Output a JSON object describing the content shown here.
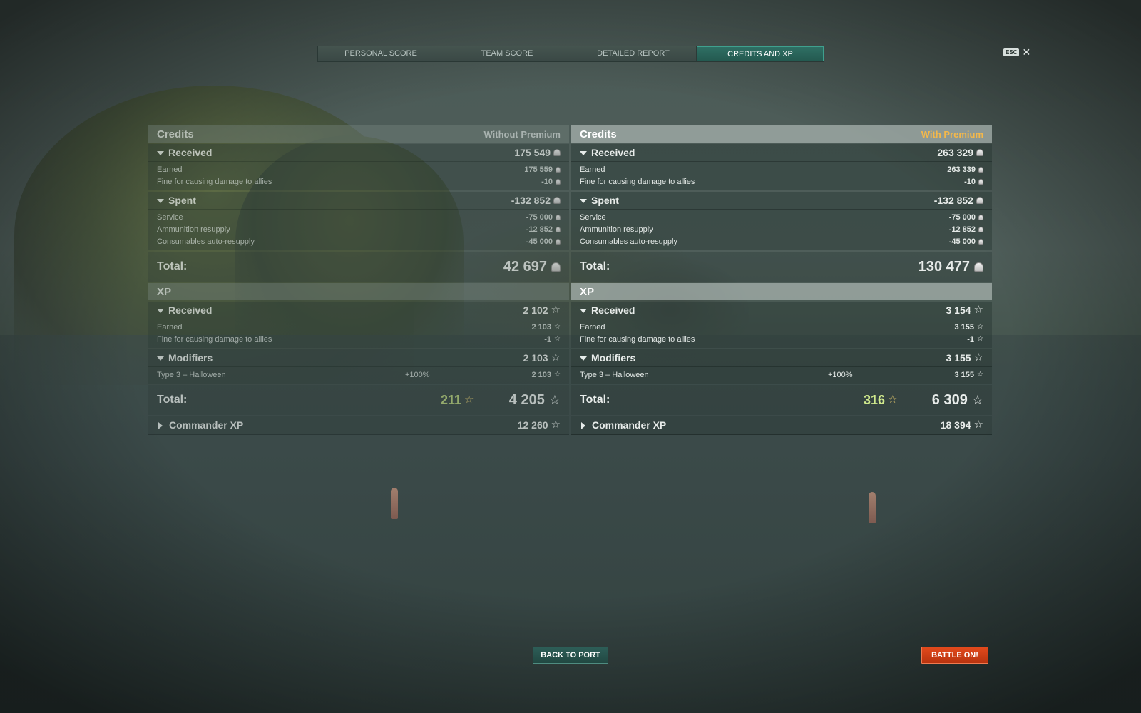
{
  "tabs": [
    {
      "label": "PERSONAL SCORE"
    },
    {
      "label": "TEAM SCORE"
    },
    {
      "label": "DETAILED REPORT"
    },
    {
      "label": "CREDITS AND XP",
      "active": true
    }
  ],
  "esc": {
    "badge": "ESC",
    "close": "✕"
  },
  "left": {
    "credits": {
      "title": "Credits",
      "subtitle": "Without Premium",
      "received": {
        "label": "Received",
        "value": "175 549"
      },
      "received_rows": [
        {
          "label": "Earned",
          "value": "175 559"
        },
        {
          "label": "Fine for causing damage to allies",
          "value": "-10"
        }
      ],
      "spent": {
        "label": "Spent",
        "value": "-132 852"
      },
      "spent_rows": [
        {
          "label": "Service",
          "value": "-75 000"
        },
        {
          "label": "Ammunition resupply",
          "value": "-12 852"
        },
        {
          "label": "Consumables auto-resupply",
          "value": "-45 000"
        }
      ],
      "total_label": "Total:",
      "total": "42 697"
    },
    "xp": {
      "title": "XP",
      "received": {
        "label": "Received",
        "value": "2 102"
      },
      "received_rows": [
        {
          "label": "Earned",
          "value": "2 103"
        },
        {
          "label": "Fine for causing damage to allies",
          "value": "-1"
        }
      ],
      "modifiers": {
        "label": "Modifiers",
        "value": "2 103"
      },
      "modifier_rows": [
        {
          "label": "Type 3 – Halloween",
          "percent": "+100%",
          "value": "2 103"
        }
      ],
      "total_label": "Total:",
      "bonus": "211",
      "total": "4 205",
      "commander": {
        "label": "Commander XP",
        "value": "12 260"
      }
    }
  },
  "right": {
    "credits": {
      "title": "Credits",
      "subtitle": "With Premium",
      "received": {
        "label": "Received",
        "value": "263 329"
      },
      "received_rows": [
        {
          "label": "Earned",
          "value": "263 339"
        },
        {
          "label": "Fine for causing damage to allies",
          "value": "-10"
        }
      ],
      "spent": {
        "label": "Spent",
        "value": "-132 852"
      },
      "spent_rows": [
        {
          "label": "Service",
          "value": "-75 000"
        },
        {
          "label": "Ammunition resupply",
          "value": "-12 852"
        },
        {
          "label": "Consumables auto-resupply",
          "value": "-45 000"
        }
      ],
      "total_label": "Total:",
      "total": "130 477"
    },
    "xp": {
      "title": "XP",
      "received": {
        "label": "Received",
        "value": "3 154"
      },
      "received_rows": [
        {
          "label": "Earned",
          "value": "3 155"
        },
        {
          "label": "Fine for causing damage to allies",
          "value": "-1"
        }
      ],
      "modifiers": {
        "label": "Modifiers",
        "value": "3 155"
      },
      "modifier_rows": [
        {
          "label": "Type 3 – Halloween",
          "percent": "+100%",
          "value": "3 155"
        }
      ],
      "total_label": "Total:",
      "bonus": "316",
      "total": "6 309",
      "commander": {
        "label": "Commander XP",
        "value": "18 394"
      }
    }
  },
  "buttons": {
    "back": "BACK TO PORT",
    "battle": "BATTLE ON!"
  },
  "colors": {
    "premium_accent": "#f4b84a",
    "active_tab": "#2f6f64",
    "battle_button": "#d8401a",
    "bonus_xp": "#cfe88c"
  },
  "icons": {
    "credit": "credit-coin-icon",
    "xp": "star-icon",
    "collapse": "triangle-down-icon",
    "expand": "triangle-right-icon"
  }
}
